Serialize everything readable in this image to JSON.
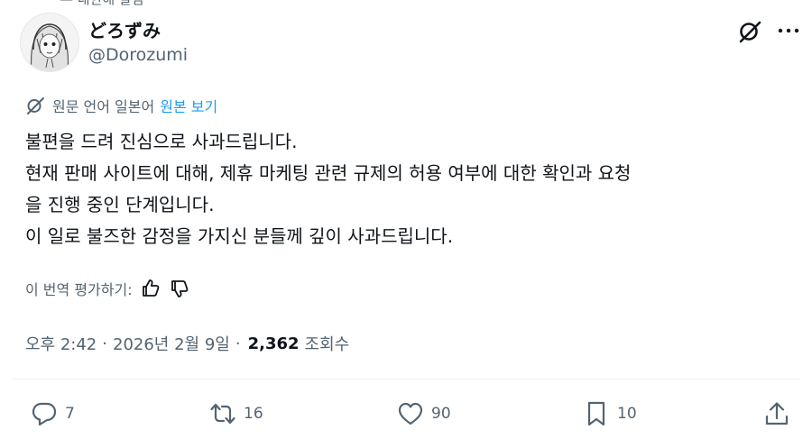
{
  "top_fade_text": "— 내한해 알림",
  "user": {
    "display_name": "どろずみ",
    "handle": "@Dorozumi"
  },
  "translation": {
    "notice": "원문 언어 일본어",
    "show_original": "원본 보기"
  },
  "tweet": {
    "text": "불편을 드려 진심으로 사과드립니다.\n현재 판매 사이트에 대해, 제휴 마케팅 관련 규제의 허용 여부에 대한 확인과 요청\n을 진행 중인 단계입니다.\n이 일로 불즈한 감정을 가지신 분들께 깊이 사과드립니다."
  },
  "rate_translation": "이 번역 평가하기:",
  "meta": {
    "time": "오후 2:42",
    "date": "2026년 2월 9일",
    "views_count": "2,362",
    "views_label": "조회수"
  },
  "actions": {
    "reply_count": "7",
    "retweet_count": "16",
    "like_count": "90",
    "bookmark_count": "10"
  },
  "colors": {
    "text": "#0f1419",
    "secondary": "#536471",
    "accent": "#1d9bf0"
  }
}
